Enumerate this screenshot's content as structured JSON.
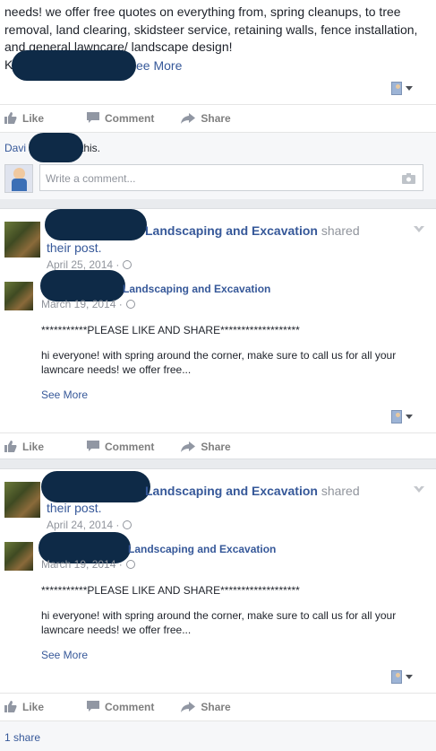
{
  "post1": {
    "text_line1": "needs! we offer free quotes on everything from, spring cleanups, to tree",
    "text_line2": "removal, land clearing, skidsteer service, retaining walls, fence installation,",
    "text_line3": "and general lawncare/ landscape design!",
    "text_prefix": "K",
    "see_more": "ee More",
    "likes_prefix": "Davi",
    "likes_suffix": "kes this.",
    "comment_placeholder": "Write a comment..."
  },
  "actions": {
    "like": "Like",
    "comment": "Comment",
    "share": "Share"
  },
  "post2": {
    "page_name": "Landscaping and Excavation",
    "shared_word": " shared",
    "their_post": "their post.",
    "date": "April 25, 2014 ·",
    "orig_name": "Landscaping and Excavation",
    "orig_date": "March 19, 2014 ·",
    "body1": "***********PLEASE LIKE AND SHARE*******************",
    "body2": "hi everyone! with spring around the corner, make sure to call us for all your",
    "body3": "lawncare needs! we offer free...",
    "see_more": "See More"
  },
  "post3": {
    "page_name": "Landscaping and Excavation",
    "shared_word": " shared",
    "their_post": "their post.",
    "date": "April 24, 2014 ·",
    "orig_name": "Landscaping and Excavation",
    "orig_date": "March 19, 2014 ·",
    "body1": "***********PLEASE LIKE AND SHARE*******************",
    "body2": "hi everyone! with spring around the corner, make sure to call us for all your",
    "body3": "lawncare needs! we offer free...",
    "see_more": "See More",
    "shares": "1 share"
  }
}
